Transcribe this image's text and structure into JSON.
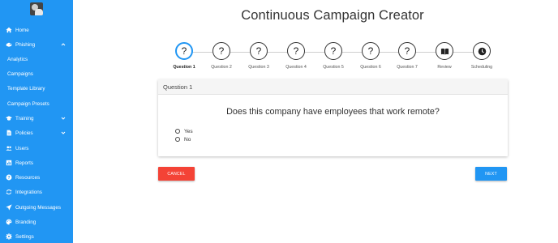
{
  "sidebar": {
    "items": [
      {
        "label": "Home",
        "icon": "home-icon"
      },
      {
        "label": "Phishing",
        "icon": "hook-icon",
        "expanded": true
      },
      {
        "label": "Analytics"
      },
      {
        "label": "Campaigns"
      },
      {
        "label": "Template Library"
      },
      {
        "label": "Campaign Presets"
      },
      {
        "label": "Training",
        "icon": "graduation-cap-icon"
      },
      {
        "label": "Policies",
        "icon": "file-icon"
      },
      {
        "label": "Users",
        "icon": "users-icon"
      },
      {
        "label": "Reports",
        "icon": "chart-icon"
      },
      {
        "label": "Resources",
        "icon": "help-circle-icon"
      },
      {
        "label": "Integrations",
        "icon": "sync-icon"
      },
      {
        "label": "Outgoing Messages",
        "icon": "send-icon"
      },
      {
        "label": "Branding",
        "icon": "palette-icon"
      },
      {
        "label": "Settings",
        "icon": "gear-icon"
      }
    ]
  },
  "main": {
    "title": "Continuous Campaign Creator",
    "steps": [
      {
        "label": "Question 1",
        "symbol": "?",
        "active": true
      },
      {
        "label": "Question 2",
        "symbol": "?"
      },
      {
        "label": "Question 3",
        "symbol": "?"
      },
      {
        "label": "Question 4",
        "symbol": "?"
      },
      {
        "label": "Question 5",
        "symbol": "?"
      },
      {
        "label": "Question 6",
        "symbol": "?"
      },
      {
        "label": "Question 7",
        "symbol": "?"
      },
      {
        "label": "Review",
        "icon": "book-icon"
      },
      {
        "label": "Scheduling",
        "icon": "clock-icon"
      }
    ],
    "card": {
      "header": "Question 1",
      "question": "Does this company have employees that work remote?",
      "options": [
        "Yes",
        "No"
      ]
    },
    "buttons": {
      "cancel": "CANCEL",
      "next": "NEXT"
    }
  },
  "colors": {
    "sidebar": "#2196f3",
    "active_step": "#2196f3",
    "cancel": "#f44336",
    "next": "#2196f3"
  }
}
